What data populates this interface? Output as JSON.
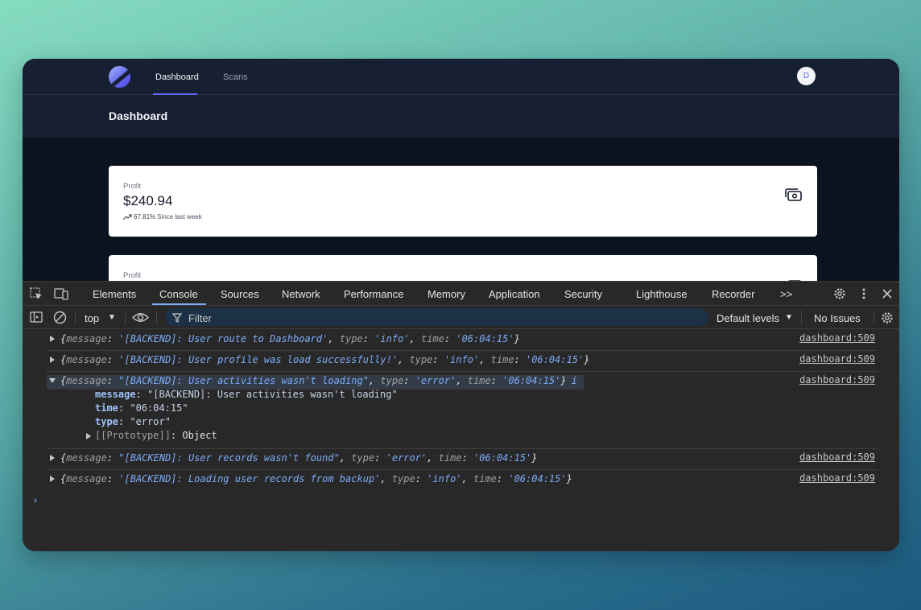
{
  "app": {
    "nav_tabs": [
      {
        "label": "Dashboard",
        "active": true
      },
      {
        "label": "Scans",
        "active": false
      }
    ],
    "avatar_initial": "D",
    "page_title": "Dashboard",
    "cards": [
      {
        "label": "Profit",
        "value": "$240.94",
        "trend_pct": "67.81%",
        "trend_text": "Since last week"
      },
      {
        "label": "Profit"
      }
    ]
  },
  "devtools": {
    "tabs": [
      "Elements",
      "Console",
      "Sources",
      "Network",
      "Performance",
      "Memory",
      "Application",
      "Security",
      "Lighthouse",
      "Recorder"
    ],
    "active_tab": "Console",
    "more_tabs": ">>",
    "toolbar": {
      "context": "top",
      "filter_placeholder": "Filter",
      "levels": "Default levels",
      "issues": "No Issues"
    },
    "logs": [
      {
        "message": "'[BACKEND]: User route to Dashboard'",
        "type": "'info'",
        "time": "'06:04:15'",
        "source": "dashboard:509"
      },
      {
        "message": "'[BACKEND]: User profile was load successfully!'",
        "type": "'info'",
        "time": "'06:04:15'",
        "source": "dashboard:509"
      },
      {
        "message": "\"[BACKEND]: User activities wasn't loading\"",
        "type": "'error'",
        "time": "'06:04:15'",
        "source": "dashboard:509",
        "expanded": {
          "message": "\"[BACKEND]: User activities wasn't loading\"",
          "time": "\"06:04:15\"",
          "type": "\"error\"",
          "prototype": "[[Prototype]]",
          "prototype_value": "Object"
        }
      },
      {
        "message": "\"[BACKEND]: User records wasn't found\"",
        "type": "'error'",
        "time": "'06:04:15'",
        "source": "dashboard:509"
      },
      {
        "message": "'[BACKEND]: Loading user records from backup'",
        "type": "'info'",
        "time": "'06:04:15'",
        "source": "dashboard:509"
      }
    ],
    "info_badge": "i",
    "colors": {
      "accent": "#7cacf8",
      "app_bg": "#0b1220",
      "devtools_bg": "#282828"
    }
  }
}
